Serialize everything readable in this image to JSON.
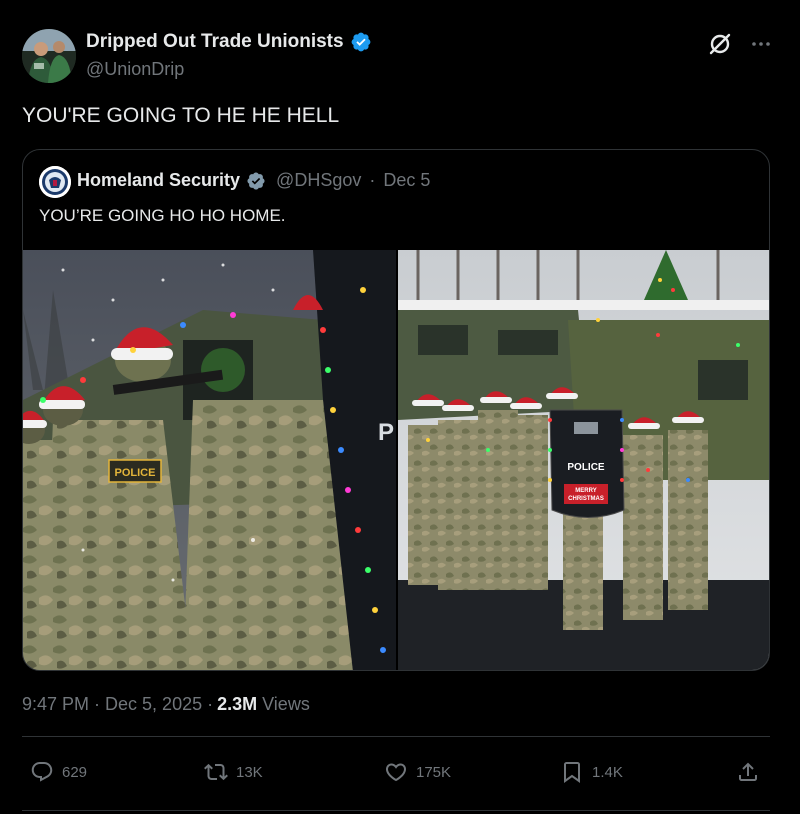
{
  "author": {
    "display_name": "Dripped Out Trade Unionists",
    "handle": "@UnionDrip",
    "verified": true
  },
  "post": {
    "text": "YOU'RE GOING TO HE HE HELL"
  },
  "quoted": {
    "display_name": "Homeland Security",
    "handle": "@DHSgov",
    "separator": "·",
    "date": "Dec 5",
    "text": "YOU’RE GOING HO HO HOME.",
    "image_left_police_label": "POLICE",
    "image_left_shield_label": "P",
    "image_right_shield_label": "POLICE",
    "image_right_shield_sub_line1": "MERRY",
    "image_right_shield_sub_line2": "CHRISTMAS"
  },
  "meta": {
    "time": "9:47 PM · Dec 5, 2025 ·",
    "views_count": "2.3M",
    "views_label": "Views"
  },
  "actions": {
    "reply_count": "629",
    "repost_count": "13K",
    "like_count": "175K",
    "bookmark_count": "1.4K"
  },
  "colors": {
    "background": "#000000",
    "text_primary": "#e7e9ea",
    "text_secondary": "#71767b",
    "border": "#2f3336",
    "verified_blue": "#1d9bf0",
    "verified_gray": "#829aab"
  },
  "icons": [
    "verified-badge-icon",
    "grok-icon",
    "more-icon",
    "reply-icon",
    "repost-icon",
    "like-icon",
    "bookmark-icon",
    "share-icon"
  ]
}
